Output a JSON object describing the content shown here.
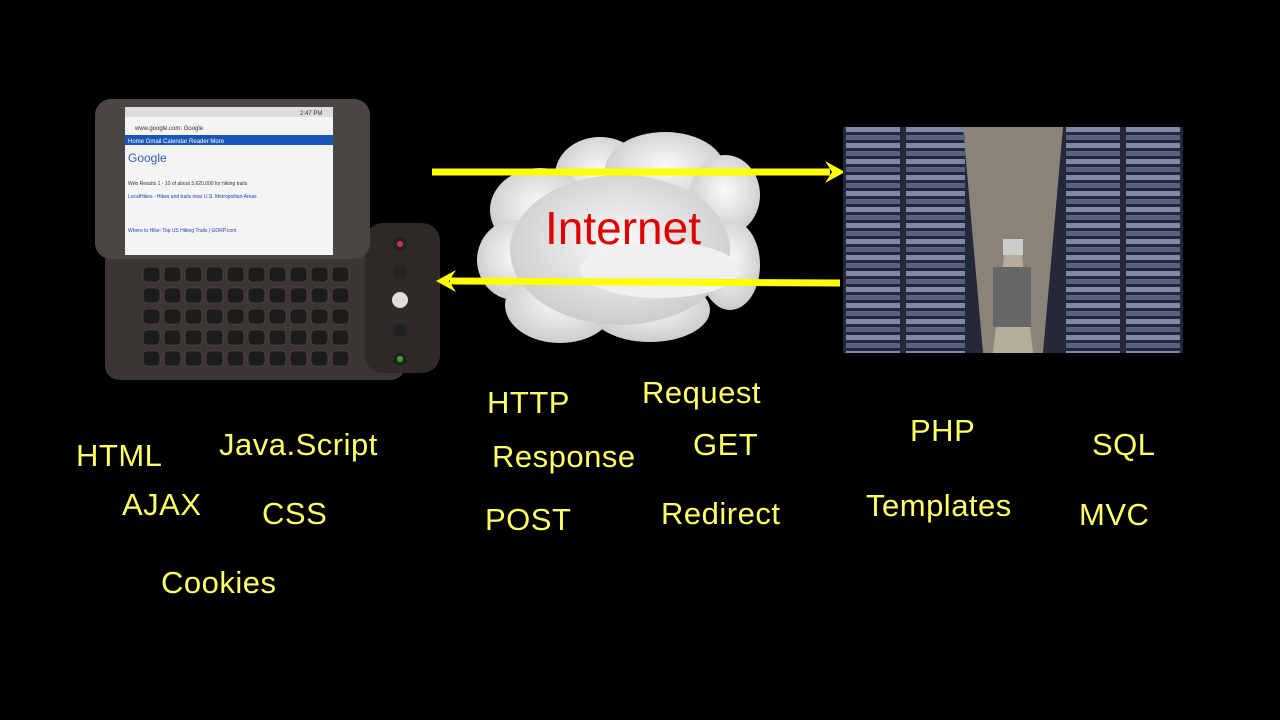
{
  "cloud": {
    "label": "Internet",
    "label_color": "#e00000"
  },
  "arrows": {
    "color": "#ffff00",
    "request_direction": "client-to-server",
    "response_direction": "server-to-client"
  },
  "label_color": "#ffff66",
  "client_terms": [
    "HTML",
    "Java.Script",
    "AJAX",
    "CSS",
    "Cookies"
  ],
  "protocol_terms": [
    "HTTP",
    "Request",
    "Response",
    "GET",
    "POST",
    "Redirect"
  ],
  "server_terms": [
    "PHP",
    "SQL",
    "Templates",
    "MVC"
  ],
  "phone_screen": {
    "time": "2:47 PM",
    "url": "www.google.com: Google",
    "nav": "Home  Gmail  Calendar  Reader  More",
    "logo": "Google",
    "results": "Web   Results 1 - 10 of about 3,620,000 for hiking trails",
    "result1": "LocalHikes - Hikes and trails near U.S. Metropolitan Areas",
    "result2": "Where to Hike: Top US Hiking Trails | GORP.com"
  }
}
